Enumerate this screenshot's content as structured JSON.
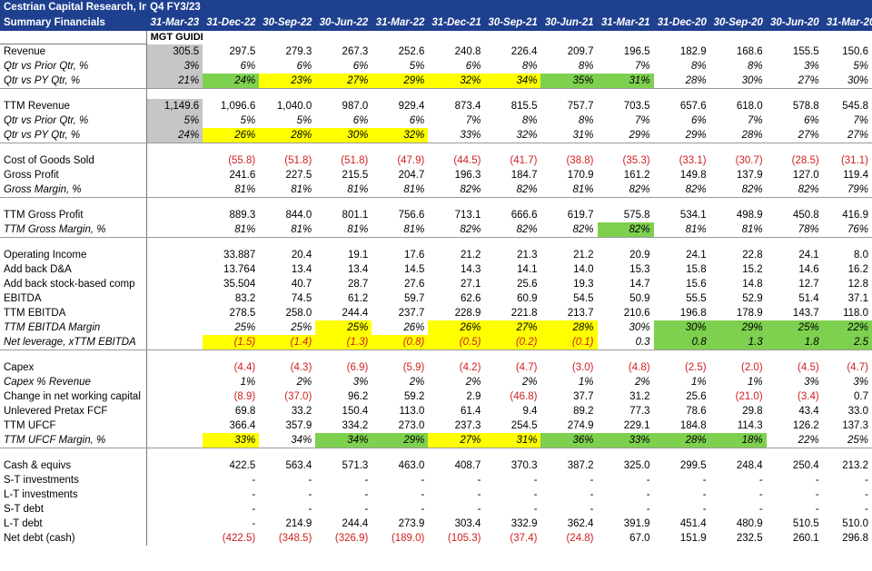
{
  "header": {
    "title_line1": "Cestrian Capital Research, Inc",
    "title_line2": "Summary Financials",
    "guide_line1": "Q4 FY3/23",
    "guide_line2": "31-Mar-23",
    "guide_tag": "MGT GUIDE",
    "dates": [
      "31-Dec-22",
      "30-Sep-22",
      "30-Jun-22",
      "31-Mar-22",
      "31-Dec-21",
      "30-Sep-21",
      "30-Jun-21",
      "31-Mar-21",
      "31-Dec-20",
      "30-Sep-20",
      "30-Jun-20",
      "31-Mar-20"
    ]
  },
  "colors": {
    "header_bg": "#1f3f8f",
    "highlight_yellow": "#ffff00",
    "highlight_green": "#7ed04f",
    "guide_grey": "#c6c6c6",
    "negative_red": "#d02020"
  },
  "rows": [
    {
      "label": "Revenue",
      "values": [
        "305.5",
        "297.5",
        "279.3",
        "267.3",
        "252.6",
        "240.8",
        "226.4",
        "209.7",
        "196.5",
        "182.9",
        "168.6",
        "155.5",
        "150.6"
      ]
    },
    {
      "label": "Qtr vs Prior Qtr, %",
      "italic": true,
      "values": [
        "3%",
        "6%",
        "6%",
        "6%",
        "5%",
        "6%",
        "8%",
        "8%",
        "7%",
        "8%",
        "8%",
        "3%",
        "5%"
      ]
    },
    {
      "label": "Qtr vs PY Qtr, %",
      "italic": true,
      "border": true,
      "values": [
        "21%",
        "24%",
        "23%",
        "27%",
        "29%",
        "32%",
        "34%",
        "35%",
        "31%",
        "28%",
        "30%",
        "27%",
        "30%"
      ],
      "hl": [
        "",
        "g",
        "y",
        "y",
        "y",
        "y",
        "y",
        "g",
        "g",
        "",
        "",
        "",
        ""
      ]
    },
    {
      "sep": true
    },
    {
      "label": "TTM Revenue",
      "values": [
        "1,149.6",
        "1,096.6",
        "1,040.0",
        "987.0",
        "929.4",
        "873.4",
        "815.5",
        "757.7",
        "703.5",
        "657.6",
        "618.0",
        "578.8",
        "545.8"
      ]
    },
    {
      "label": "Qtr vs Prior Qtr, %",
      "italic": true,
      "values": [
        "5%",
        "5%",
        "5%",
        "6%",
        "6%",
        "7%",
        "8%",
        "8%",
        "7%",
        "6%",
        "7%",
        "6%",
        "7%"
      ]
    },
    {
      "label": "Qtr vs PY Qtr, %",
      "italic": true,
      "border": true,
      "values": [
        "24%",
        "26%",
        "28%",
        "30%",
        "32%",
        "33%",
        "32%",
        "31%",
        "29%",
        "29%",
        "28%",
        "27%",
        "27%"
      ],
      "hl": [
        "",
        "y",
        "y",
        "y",
        "y",
        "",
        "",
        "",
        "",
        "",
        "",
        "",
        ""
      ]
    },
    {
      "sep": true
    },
    {
      "label": "Cost of Goods Sold",
      "red": true,
      "values": [
        "",
        "(55.8)",
        "(51.8)",
        "(51.8)",
        "(47.9)",
        "(44.5)",
        "(41.7)",
        "(38.8)",
        "(35.3)",
        "(33.1)",
        "(30.7)",
        "(28.5)",
        "(31.1)"
      ]
    },
    {
      "label": "Gross Profit",
      "values": [
        "",
        "241.6",
        "227.5",
        "215.5",
        "204.7",
        "196.3",
        "184.7",
        "170.9",
        "161.2",
        "149.8",
        "137.9",
        "127.0",
        "119.4"
      ]
    },
    {
      "label": "Gross Margin, %",
      "italic": true,
      "border": true,
      "values": [
        "",
        "81%",
        "81%",
        "81%",
        "81%",
        "82%",
        "82%",
        "81%",
        "82%",
        "82%",
        "82%",
        "82%",
        "79%"
      ]
    },
    {
      "sep": true
    },
    {
      "label": "TTM Gross Profit",
      "values": [
        "",
        "889.3",
        "844.0",
        "801.1",
        "756.6",
        "713.1",
        "666.6",
        "619.7",
        "575.8",
        "534.1",
        "498.9",
        "450.8",
        "416.9"
      ]
    },
    {
      "label": "TTM Gross Margin, %",
      "italic": true,
      "border": true,
      "values": [
        "",
        "81%",
        "81%",
        "81%",
        "81%",
        "82%",
        "82%",
        "82%",
        "82%",
        "81%",
        "81%",
        "78%",
        "76%"
      ],
      "hl": [
        "",
        "",
        "",
        "",
        "",
        "",
        "",
        "",
        "g",
        "",
        "",
        "",
        ""
      ]
    },
    {
      "sep": true
    },
    {
      "label": "Operating Income",
      "values": [
        "",
        "33.887",
        "20.4",
        "19.1",
        "17.6",
        "21.2",
        "21.3",
        "21.2",
        "20.9",
        "24.1",
        "22.8",
        "24.1",
        "8.0"
      ]
    },
    {
      "label": "Add back D&A",
      "values": [
        "",
        "13.764",
        "13.4",
        "13.4",
        "14.5",
        "14.3",
        "14.1",
        "14.0",
        "15.3",
        "15.8",
        "15.2",
        "14.6",
        "16.2"
      ]
    },
    {
      "label": "Add back stock-based comp",
      "values": [
        "",
        "35.504",
        "40.7",
        "28.7",
        "27.6",
        "27.1",
        "25.6",
        "19.3",
        "14.7",
        "15.6",
        "14.8",
        "12.7",
        "12.8"
      ]
    },
    {
      "label": "EBITDA",
      "values": [
        "",
        "83.2",
        "74.5",
        "61.2",
        "59.7",
        "62.6",
        "60.9",
        "54.5",
        "50.9",
        "55.5",
        "52.9",
        "51.4",
        "37.1"
      ]
    },
    {
      "label": "TTM EBITDA",
      "values": [
        "",
        "278.5",
        "258.0",
        "244.4",
        "237.7",
        "228.9",
        "221.8",
        "213.7",
        "210.6",
        "196.8",
        "178.9",
        "143.7",
        "118.0"
      ]
    },
    {
      "label": "TTM EBITDA Margin",
      "italic": true,
      "values": [
        "",
        "25%",
        "25%",
        "25%",
        "26%",
        "26%",
        "27%",
        "28%",
        "30%",
        "30%",
        "29%",
        "25%",
        "22%"
      ],
      "hl": [
        "",
        "",
        "",
        "y",
        "",
        "y",
        "y",
        "y",
        "",
        "g",
        "g",
        "g",
        "g"
      ]
    },
    {
      "label": "Net leverage, xTTM EBITDA",
      "italic": true,
      "border": true,
      "values": [
        "",
        "(1.5)",
        "(1.4)",
        "(1.3)",
        "(0.8)",
        "(0.5)",
        "(0.2)",
        "(0.1)",
        "0.3",
        "0.8",
        "1.3",
        "1.8",
        "2.5"
      ],
      "red": true,
      "hl": [
        "",
        "y",
        "y",
        "y",
        "y",
        "y",
        "y",
        "y",
        "",
        "g",
        "g",
        "g",
        "g"
      ]
    },
    {
      "sep": true
    },
    {
      "label": "Capex",
      "red": true,
      "values": [
        "",
        "(4.4)",
        "(4.3)",
        "(6.9)",
        "(5.9)",
        "(4.2)",
        "(4.7)",
        "(3.0)",
        "(4.8)",
        "(2.5)",
        "(2.0)",
        "(4.5)",
        "(4.7)"
      ]
    },
    {
      "label": "Capex % Revenue",
      "italic": true,
      "values": [
        "",
        "1%",
        "2%",
        "3%",
        "2%",
        "2%",
        "2%",
        "1%",
        "2%",
        "1%",
        "1%",
        "3%",
        "3%"
      ]
    },
    {
      "label": "Change in net working capital",
      "values": [
        "",
        "(8.9)",
        "(37.0)",
        "96.2",
        "59.2",
        "2.9",
        "(46.8)",
        "37.7",
        "31.2",
        "25.6",
        "(21.0)",
        "(3.4)",
        "0.7"
      ]
    },
    {
      "label": "Unlevered Pretax FCF",
      "values": [
        "",
        "69.8",
        "33.2",
        "150.4",
        "113.0",
        "61.4",
        "9.4",
        "89.2",
        "77.3",
        "78.6",
        "29.8",
        "43.4",
        "33.0"
      ]
    },
    {
      "label": "TTM UFCF",
      "values": [
        "",
        "366.4",
        "357.9",
        "334.2",
        "273.0",
        "237.3",
        "254.5",
        "274.9",
        "229.1",
        "184.8",
        "114.3",
        "126.2",
        "137.3"
      ]
    },
    {
      "label": "TTM UFCF Margin, %",
      "italic": true,
      "border": true,
      "values": [
        "",
        "33%",
        "34%",
        "34%",
        "29%",
        "27%",
        "31%",
        "36%",
        "33%",
        "28%",
        "18%",
        "22%",
        "25%"
      ],
      "hl": [
        "",
        "y",
        "",
        "g",
        "g",
        "y",
        "y",
        "g",
        "g",
        "g",
        "g",
        "",
        ""
      ]
    },
    {
      "sep": true
    },
    {
      "label": "Cash & equivs",
      "values": [
        "",
        "422.5",
        "563.4",
        "571.3",
        "463.0",
        "408.7",
        "370.3",
        "387.2",
        "325.0",
        "299.5",
        "248.4",
        "250.4",
        "213.2"
      ]
    },
    {
      "label": "S-T investments",
      "values": [
        "",
        "-",
        "-",
        "-",
        "-",
        "-",
        "-",
        "-",
        "-",
        "-",
        "-",
        "-",
        "-"
      ]
    },
    {
      "label": "L-T investments",
      "values": [
        "",
        "-",
        "-",
        "-",
        "-",
        "-",
        "-",
        "-",
        "-",
        "-",
        "-",
        "-",
        "-"
      ]
    },
    {
      "label": "S-T debt",
      "values": [
        "",
        "-",
        "-",
        "-",
        "-",
        "-",
        "-",
        "-",
        "-",
        "-",
        "-",
        "-",
        "-"
      ]
    },
    {
      "label": "L-T debt",
      "values": [
        "",
        "-",
        "214.9",
        "244.4",
        "273.9",
        "303.4",
        "332.9",
        "362.4",
        "391.9",
        "451.4",
        "480.9",
        "510.5",
        "510.0"
      ]
    },
    {
      "label": "Net debt (cash)",
      "values": [
        "",
        "(422.5)",
        "(348.5)",
        "(326.9)",
        "(189.0)",
        "(105.3)",
        "(37.4)",
        "(24.8)",
        "67.0",
        "151.9",
        "232.5",
        "260.1",
        "296.8"
      ]
    }
  ]
}
